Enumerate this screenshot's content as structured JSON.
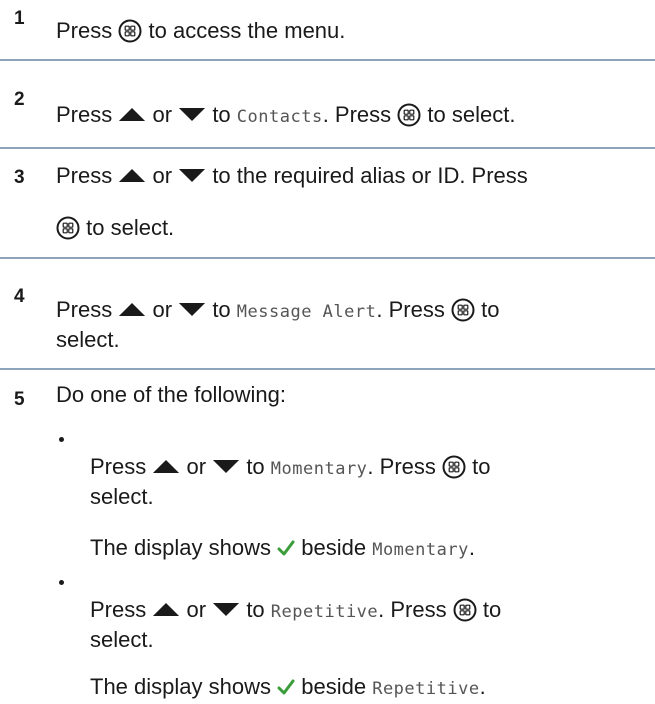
{
  "steps": [
    {
      "num": "1",
      "text_a": "Press",
      "text_b": "to access the menu."
    },
    {
      "num": "2",
      "text_a": "Press",
      "or": "or",
      "to": "to",
      "target": "Contacts",
      "period": ". Press",
      "select": "to select."
    },
    {
      "num": "3",
      "text_a": "Press",
      "or": "or",
      "line1_end": "to the required alias or ID. Press",
      "select": "to select."
    },
    {
      "num": "4",
      "text_a": "Press",
      "or": "or",
      "to": "to",
      "target": "Message Alert",
      "period": ". Press",
      "to2": "to",
      "select_line": "select."
    },
    {
      "num": "5",
      "text": "Do one of the following:"
    }
  ],
  "options": [
    {
      "text_a": "Press",
      "or": "or",
      "to": "to",
      "target": "Momentary",
      "period": ". Press",
      "to2": "to",
      "select_line": "select.",
      "display_text": "The display shows",
      "beside": "beside",
      "display_target": "Momentary",
      "display_end": "."
    },
    {
      "text_a": "Press",
      "or": "or",
      "to": "to",
      "target": "Repetitive",
      "period": ". Press",
      "to2": "to",
      "select_line": "select.",
      "display_text": "The display shows",
      "beside": "beside",
      "display_target": "Repetitive",
      "display_end": "."
    }
  ],
  "icons": {
    "menu_ok": "menu-ok-button-icon",
    "up": "up-arrow-icon",
    "down": "down-arrow-icon",
    "check": "checkmark-icon"
  },
  "colors": {
    "rule": "#8ea4bd",
    "check": "#3a9c3a",
    "text": "#1a1a1a"
  }
}
